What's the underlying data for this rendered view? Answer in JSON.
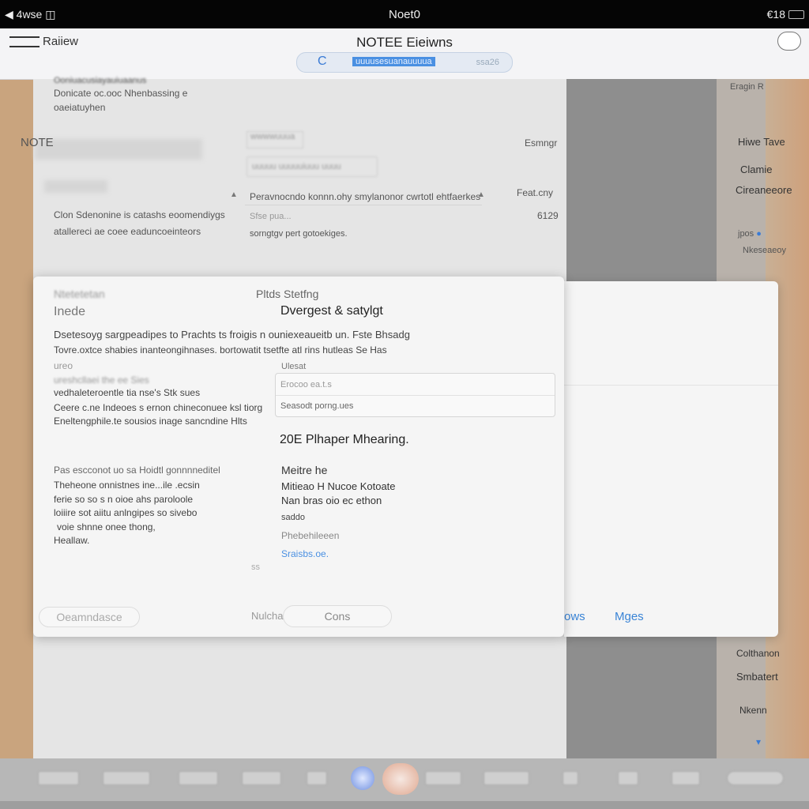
{
  "status": {
    "left": "4wse",
    "carrier_icon": "wifi-icon",
    "center": "Noet0",
    "right": "€18"
  },
  "nav": {
    "back_label": "Raiiew",
    "title": "NOTEE Eieiwns",
    "search_icon": "C",
    "search_query": "uuuusesuanauuuua",
    "search_right": "ssa26"
  },
  "bg": {
    "top_lines": [
      "Ooniuacusiayauiuaanus",
      "Donicate oc.ooc Nhenbassing e",
      "oaeiatuyhen"
    ],
    "note_label": "NOTE",
    "pill1": "wwwwuuua",
    "pill2": "uuuuu uuuuuiuuu uuuu",
    "right_label1": "Esmngr",
    "caption": "Peravnocndo konnn.ohy smylanonor cwrtotl ehtfaerkes",
    "right_label2": "Feat.cny",
    "desc_lines": [
      "Clon Sdenonine is catashs eoomendiygs",
      "atallereci ae coee eaduncoeinteors"
    ],
    "sub1": "Sfse pua...",
    "sub2": "sorngtgv pert gotoekiges.",
    "right_num": "6129"
  },
  "right_sidebar": {
    "label_top": "Eragin R",
    "items": [
      "Hiwe Tave",
      "Clamie",
      "Cireaneeore"
    ],
    "link": "jpos",
    "link2": "Nkeseaeoy",
    "bottom": [
      "Colthanon",
      "Smbatert",
      "Nkenn"
    ]
  },
  "dialog": {
    "left_title": "Ntetetetan",
    "left_subtitle": "Inede",
    "heading_small": "Pltds Stetfng",
    "heading": "Dvergest & satylgt",
    "intro_lines": [
      "Dsetesoyg sargpeadipes to Prachts ts froigis n ouniexeaueitb un. Fste Bhsadg",
      "Tovre.oxtce shabies inanteongihnases. bortowatit tsetfte atl rins hutleas Se Has"
    ],
    "left_lines1": [
      "ureo",
      "ureshcllaei the ee Sies",
      "vedhaleteroentle tia nse's Stk sues",
      "Ceere c.ne Indeoes s ernon chineconuee ksl tiorg",
      "Eneltengphile.te sousios inage sancndine Hlts"
    ],
    "field_label": "Ulesat",
    "field1": "Erocoo ea.t.s",
    "field2": "Seasodt porng.ues",
    "left_lines2": [
      "Pas escconot uo sa Hoidtl gonnnneditel",
      "Theheone onnistnes ine...ile .ecsin",
      "ferie so so s n oioe ahs paroloole",
      "loiiire sot aiitu anlngipes so sivebo",
      "voie shnne onee thong,",
      "Heallaw."
    ],
    "meeting_title": "20E Plhaper Mhearing.",
    "meeting_lines": [
      "Meitre he",
      "Mitieao H Nucoe Kotoate",
      "Nan bras oio ec ethon",
      "saddo"
    ],
    "meeting_muted": "Phebehileeen",
    "meeting_link": "Sraisbs.oe.",
    "left_page_num": "ss",
    "btn_left": "Oeamndasce",
    "btn_mid_label": "Nulcha",
    "btn_right": "Cons ",
    "sheet_btn1": "ows",
    "sheet_btn2": "Mges"
  },
  "colors": {
    "accent": "#3a84d6",
    "link": "#4a90e2"
  }
}
